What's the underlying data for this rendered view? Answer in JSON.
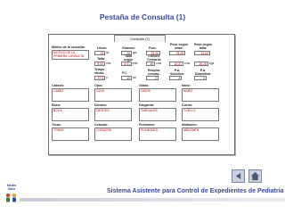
{
  "slide": {
    "title": "Pestaña de Consulta (1)"
  },
  "form": {
    "tab_label": "Consulta (1)",
    "motivo": {
      "label": "Motivo de la consulta:",
      "value": "MOTIVO DE LA PRIMERA CONSULTA"
    },
    "labels": {
      "litros": "Litros:",
      "gramos": "Gramos:",
      "fum": "Fum:",
      "peso_edad": "Peso según edad:",
      "peso_talla": "Peso según talla:",
      "talla": "Talla:",
      "talla_edad": "Talla según edad:",
      "circunf_cerebral": "Circunf. Cerebral:",
      "tempe": "Tempe. ratura:",
      "fc": "FC:",
      "resp_minuto": "Respira. minuto:",
      "pa_sistolica": "P.A. Sistólica:",
      "pa_diastolica": "P.A. Diastólica:"
    },
    "values": {
      "litros": "15",
      "gramos": "25",
      "fum": "15.25",
      "peso_edad": "75.25",
      "peso_talla": "15.00",
      "talla": "8.00",
      "talla_edad": "8.01",
      "circunf_cerebral": "45",
      "circunf2": "15.21",
      "circunf3": "25.28",
      "tempe": "37.5",
      "fc": "45",
      "resp_minuto": "2",
      "pa_sistolica": "3",
      "pa_diastolica": "5"
    },
    "units": {
      "litros": "lts",
      "gramos": "grs",
      "talla": "mts",
      "talla_edad": "mts",
      "circunf_cerebral": "cms",
      "circunf2": "cms",
      "circunf3": "kgs",
      "tempe": "C",
      "fc": "lat",
      "resp_minuto": "",
      "pa_sistolica": "",
      "pa_diastolica": ""
    },
    "areas": [
      {
        "label": "Cabeza:",
        "value": "CABEZ"
      },
      {
        "label": "Ojos:",
        "value": "OJOS"
      },
      {
        "label": "Oídos:",
        "value": "OIDOS"
      },
      {
        "label": "Nariz:",
        "value": "NARIZ"
      },
      {
        "label": "Boca:",
        "value": "BOCA"
      },
      {
        "label": "Dientes:",
        "value": "DIENTES"
      },
      {
        "label": "Garganta:",
        "value": "GARGANTA"
      },
      {
        "label": "Cuello:",
        "value": "CUELLO"
      },
      {
        "label": "Tórax:",
        "value": "TÓRAX"
      },
      {
        "label": "Corazón:",
        "value": "CORAZÓN"
      },
      {
        "label": "Pulmones:",
        "value": "PULMONES"
      },
      {
        "label": "Abdomen:",
        "value": "ABDOMEN"
      }
    ]
  },
  "footer": {
    "logo_text": "Medio Sano",
    "text": "Sistema Asistente para Control de Expedientes de Pediatria"
  },
  "colors": {
    "title": "#3a4a9a",
    "field_text": "#b00000",
    "nav_button": "#c9d2df"
  }
}
